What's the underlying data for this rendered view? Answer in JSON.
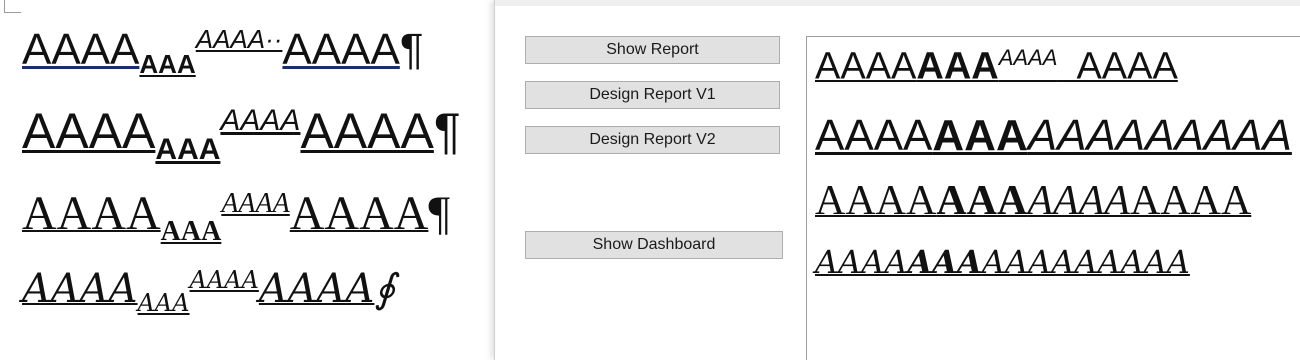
{
  "document": {
    "line1": {
      "base": "AAAA",
      "sub": "AAA",
      "sup": "AAAA··",
      "tail": "AAAA",
      "mark": "¶"
    },
    "line2": {
      "base": "AAAA",
      "sub": "AAA",
      "sup": "AAAA",
      "tail": "AAAA",
      "mark": "¶"
    },
    "line3": {
      "base": "AAAA",
      "sub": "AAA",
      "sup": "AAAA",
      "tail": "AAAA",
      "mark": "¶"
    },
    "line4": {
      "base": "AAAA",
      "sub": "AAA",
      "sup": "AAAA",
      "tail": "AAAA",
      "mark": "∮"
    }
  },
  "buttons": {
    "show_report": "Show Report",
    "design_v1": "Design Report V1",
    "design_v2": "Design Report V2",
    "show_dashboard": "Show Dashboard"
  },
  "preview": {
    "line1": {
      "a": "AAAA",
      "b": "AAA",
      "c": "AAAA",
      "d": "  AAAA"
    },
    "line2": {
      "a": "AAAA",
      "b": "AAA",
      "c": "AAAAAAAAA"
    },
    "line3": {
      "a": "AAAA",
      "b": "AAA",
      "c": "AAAA",
      "d": "AAAA"
    },
    "line4": {
      "a": "AAAA",
      "b": "AAA",
      "c": "AAAAAAAAA"
    }
  },
  "colors": {
    "button_bg": "#e1e1e1",
    "button_border": "#adadad",
    "underline_line1": "#1a2f6e"
  }
}
